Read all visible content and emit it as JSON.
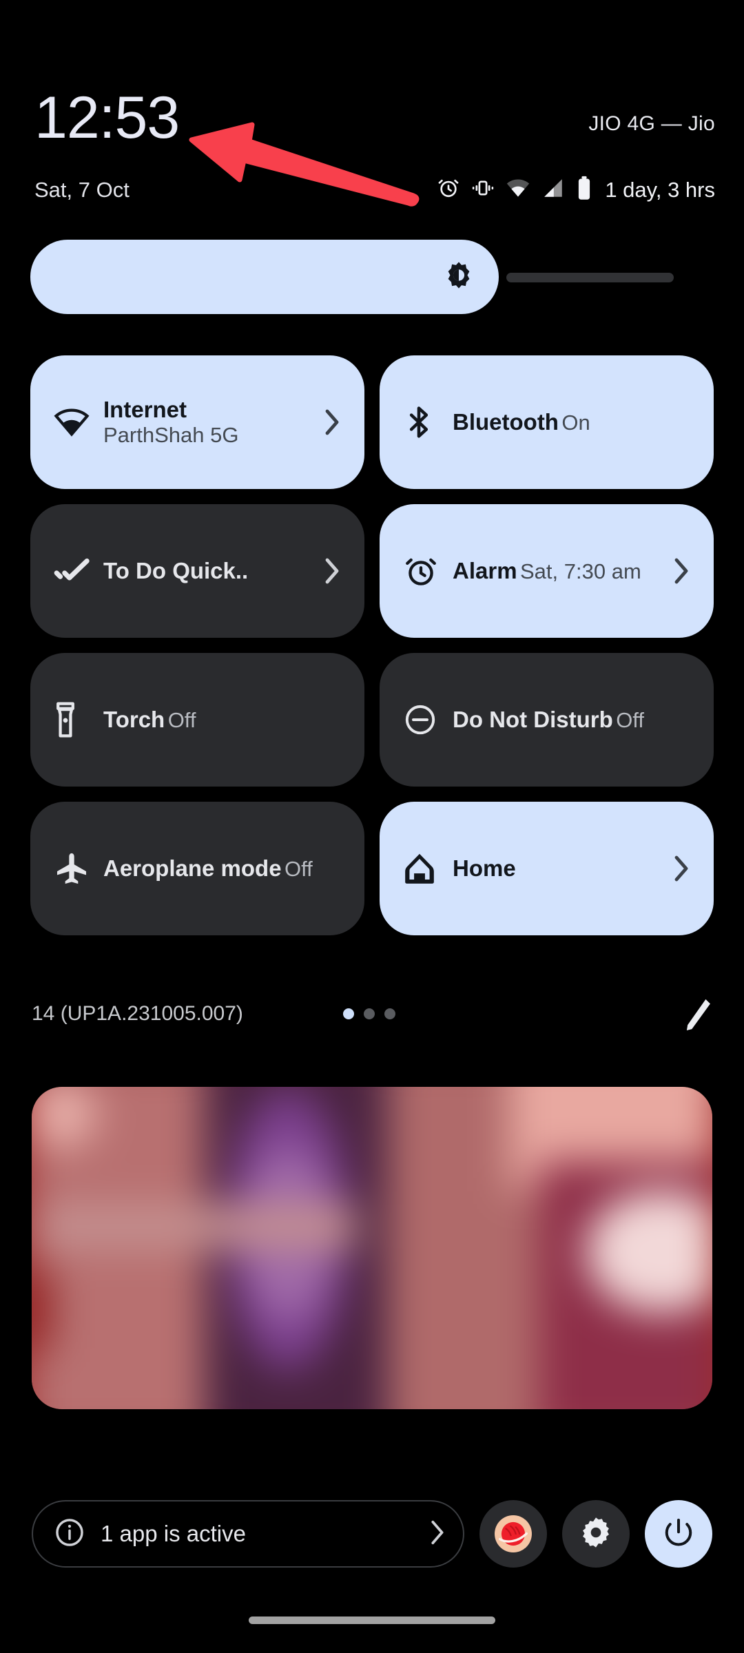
{
  "status_bar": {
    "clock": "12:53",
    "date": "Sat, 7 Oct",
    "carrier": "JIO 4G — Jio",
    "battery_estimate": "1 day, 3 hrs",
    "icons": [
      "alarm-icon",
      "vibrate-icon",
      "wifi-icon",
      "signal-icon",
      "battery-icon"
    ]
  },
  "brightness": {
    "icon": "brightness-icon",
    "level_percent": 69
  },
  "tiles": [
    {
      "label": "Internet",
      "sub": "ParthShah 5G",
      "icon": "wifi-icon",
      "active": true,
      "chevron": true
    },
    {
      "label": "Bluetooth",
      "sub": "On",
      "icon": "bluetooth-icon",
      "active": true,
      "chevron": false
    },
    {
      "label": "To Do Quick..",
      "sub": "",
      "icon": "double-check-icon",
      "active": false,
      "chevron": true
    },
    {
      "label": "Alarm",
      "sub": "Sat, 7:30 am",
      "icon": "alarm-icon",
      "active": true,
      "chevron": true
    },
    {
      "label": "Torch",
      "sub": "Off",
      "icon": "torch-icon",
      "active": false,
      "chevron": false
    },
    {
      "label": "Do Not Disturb",
      "sub": "Off",
      "icon": "dnd-icon",
      "active": false,
      "chevron": false
    },
    {
      "label": "Aeroplane mode",
      "sub": "Off",
      "icon": "airplane-icon",
      "active": false,
      "chevron": false
    },
    {
      "label": "Home",
      "sub": "",
      "icon": "home-icon",
      "active": true,
      "chevron": true
    }
  ],
  "qs_footer": {
    "build": "14 (UP1A.231005.007)",
    "pages": 3,
    "current_page": 1,
    "edit_icon": "pencil-icon"
  },
  "media_card": {
    "content": "blurred-notification-image"
  },
  "bottom_bar": {
    "active_apps_label": "1 app is active",
    "info_icon": "info-icon",
    "chevron_icon": "chevron-right-icon",
    "avatar_icon": "user-avatar-icon",
    "settings_icon": "gear-icon",
    "power_icon": "power-icon"
  },
  "annotation": {
    "arrow_color": "#f8404c",
    "points_to": "clock"
  },
  "colors": {
    "background": "#000000",
    "tile_active": "#d3e3fd",
    "tile_inactive": "#2a2b2e",
    "accent_red": "#f8404c"
  }
}
